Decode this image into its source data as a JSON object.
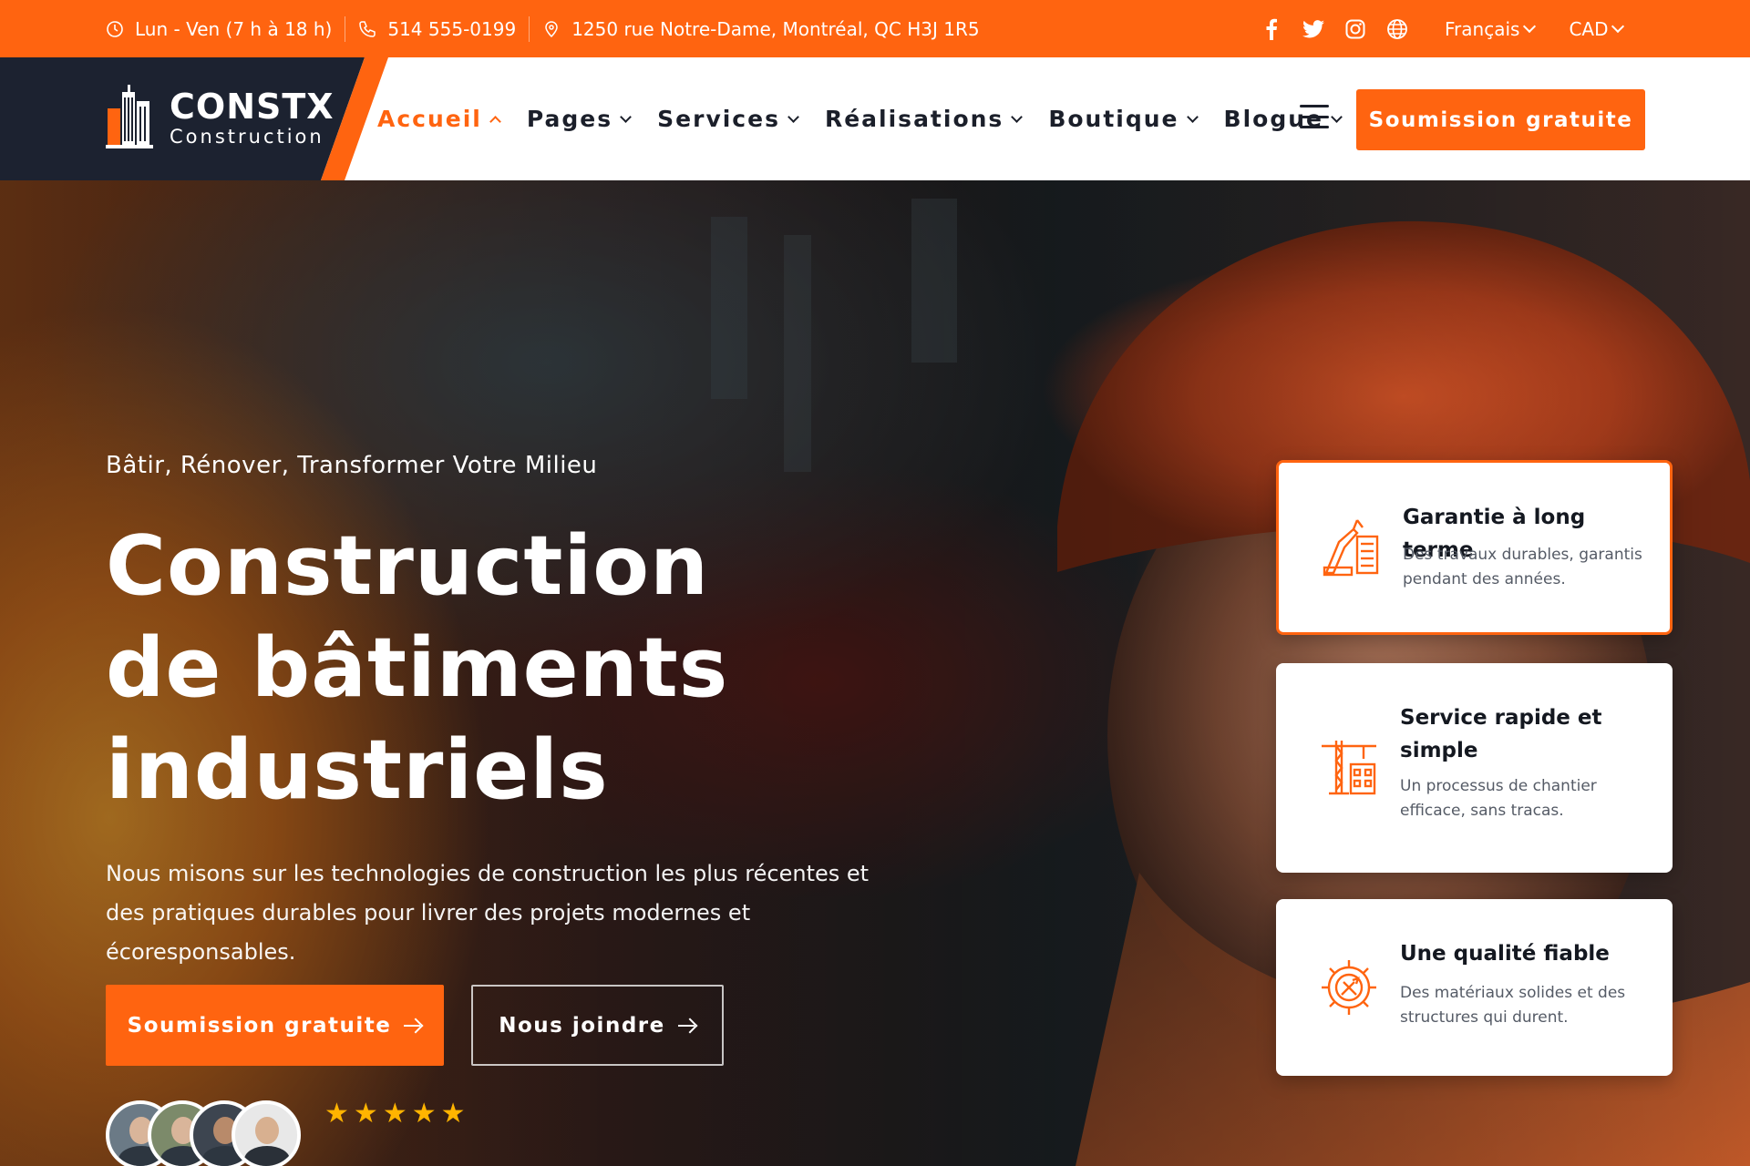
{
  "topbar": {
    "hours": "Lun - Ven (7 h à 18 h)",
    "phone": "514 555-0199",
    "address": "1250 rue Notre-Dame, Montréal, QC H3J 1R5",
    "social": [
      "facebook-icon",
      "twitter-icon",
      "instagram-icon",
      "globe-icon"
    ],
    "language": "Français",
    "currency": "CAD",
    "background": "#ff6410"
  },
  "brand": {
    "name": "CONSTX",
    "subtitle": "Construction",
    "panel_color": "#1c2230",
    "accent": "#ff6410"
  },
  "nav": {
    "items": [
      {
        "label": "Accueil",
        "active": true
      },
      {
        "label": "Pages"
      },
      {
        "label": "Services"
      },
      {
        "label": "Réalisations"
      },
      {
        "label": "Boutique"
      },
      {
        "label": "Blogue"
      }
    ],
    "cta": "Soumission gratuite"
  },
  "hero": {
    "tagline": "Bâtir, Rénover, Transformer Votre Milieu",
    "title_lines": [
      "Construction",
      "de bâtiments",
      "industriels"
    ],
    "description": "Nous misons sur les technologies de construction les plus récentes et des pratiques durables pour livrer des projets modernes et écoresponsables.",
    "primary_button": "Soumission gratuite",
    "secondary_button": "Nous joindre",
    "rating_stars": 5
  },
  "features": [
    {
      "icon": "crane-building-icon",
      "title": "Garantie à long terme",
      "text": "Des travaux durables, garantis pendant des années.",
      "highlighted": true
    },
    {
      "icon": "tower-crane-icon",
      "title": "Service rapide et simple",
      "text": "Un processus de chantier efficace, sans tracas."
    },
    {
      "icon": "gear-tools-icon",
      "title": "Une qualité fiable",
      "text": "Des matériaux solides et des structures qui durent."
    }
  ]
}
